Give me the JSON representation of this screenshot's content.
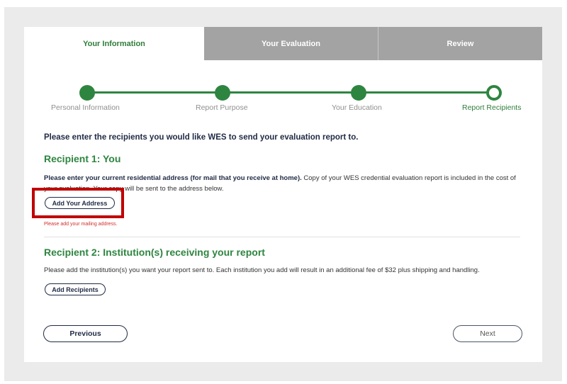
{
  "tabs": [
    {
      "label": "Your Information",
      "active": true
    },
    {
      "label": "Your Evaluation",
      "active": false
    },
    {
      "label": "Review",
      "active": false
    }
  ],
  "steps": [
    {
      "label": "Personal Information",
      "status": "complete"
    },
    {
      "label": "Report Purpose",
      "status": "complete"
    },
    {
      "label": "Your Education",
      "status": "complete"
    },
    {
      "label": "Report Recipients",
      "status": "current"
    }
  ],
  "intro": "Please enter the recipients you would like WES to send your evaluation report to.",
  "recipient1": {
    "title": "Recipient 1: You",
    "desc_bold": "Please enter your current residential address (for mail that you receive at home).",
    "desc_rest": " Copy of your WES credential evaluation report is included in the cost of your evaluation. Your copy will be sent to the address below.",
    "button": "Add Your Address",
    "error": "Please add your mailing address."
  },
  "recipient2": {
    "title": "Recipient 2: Institution(s) receiving your report",
    "desc": "Please add the institution(s) you want your report sent to. Each institution you add will result in an additional fee of $32 plus shipping and handling.",
    "button": "Add Recipients"
  },
  "nav": {
    "previous": "Previous",
    "next": "Next"
  },
  "colors": {
    "accent": "#2e8540",
    "highlight": "#c00000",
    "error": "#d32f2f",
    "navy": "#1f2a44"
  }
}
